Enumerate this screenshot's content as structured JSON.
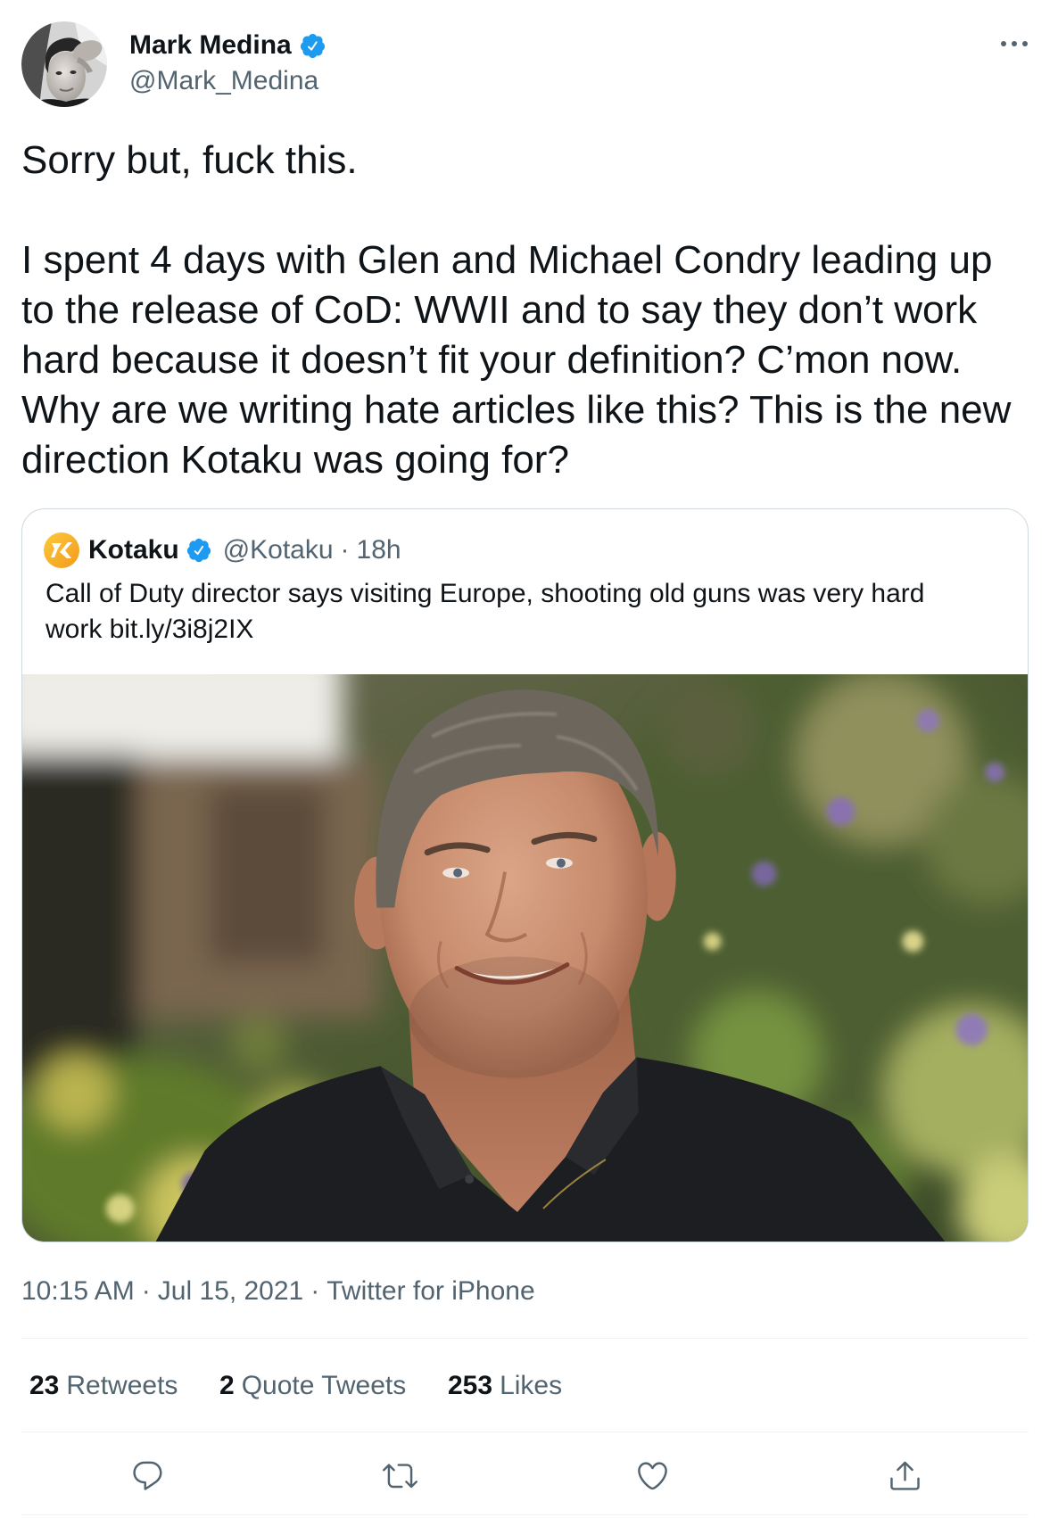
{
  "author": {
    "name": "Mark Medina",
    "handle": "@Mark_Medina",
    "verified": true
  },
  "more_icon": "more-dots-icon",
  "tweet": {
    "paragraphs": [
      "Sorry but, fuck this.",
      "I spent 4 days with Glen and Michael Condry leading up to the release of CoD: WWII and to say they don’t work hard because it doesn’t fit your definition? C’mon now. Why are we writing hate articles like this? This is the new direction Kotaku was going for?"
    ]
  },
  "quoted_tweet": {
    "name": "Kotaku",
    "handle": "@Kotaku",
    "separator": "·",
    "age": "18h",
    "verified": true,
    "logo_icon": "kotaku-logo-icon",
    "text": "Call of Duty director says visiting Europe, shooting old guns was very hard work bit.ly/3i8j2IX"
  },
  "meta": {
    "time": "10:15 AM",
    "separator": "·",
    "date": "Jul 15, 2021",
    "source": "Twitter for iPhone"
  },
  "stats": [
    {
      "count": "23",
      "label": "Retweets"
    },
    {
      "count": "2",
      "label": "Quote Tweets"
    },
    {
      "count": "253",
      "label": "Likes"
    }
  ],
  "actions": [
    {
      "icon": "reply-icon"
    },
    {
      "icon": "retweet-icon"
    },
    {
      "icon": "like-icon"
    },
    {
      "icon": "share-icon"
    }
  ],
  "colors": {
    "text": "#0f1419",
    "secondary": "#536471",
    "verified": "#1d9bf0",
    "card_border": "#cfd9de",
    "divider": "#eff3f4"
  }
}
